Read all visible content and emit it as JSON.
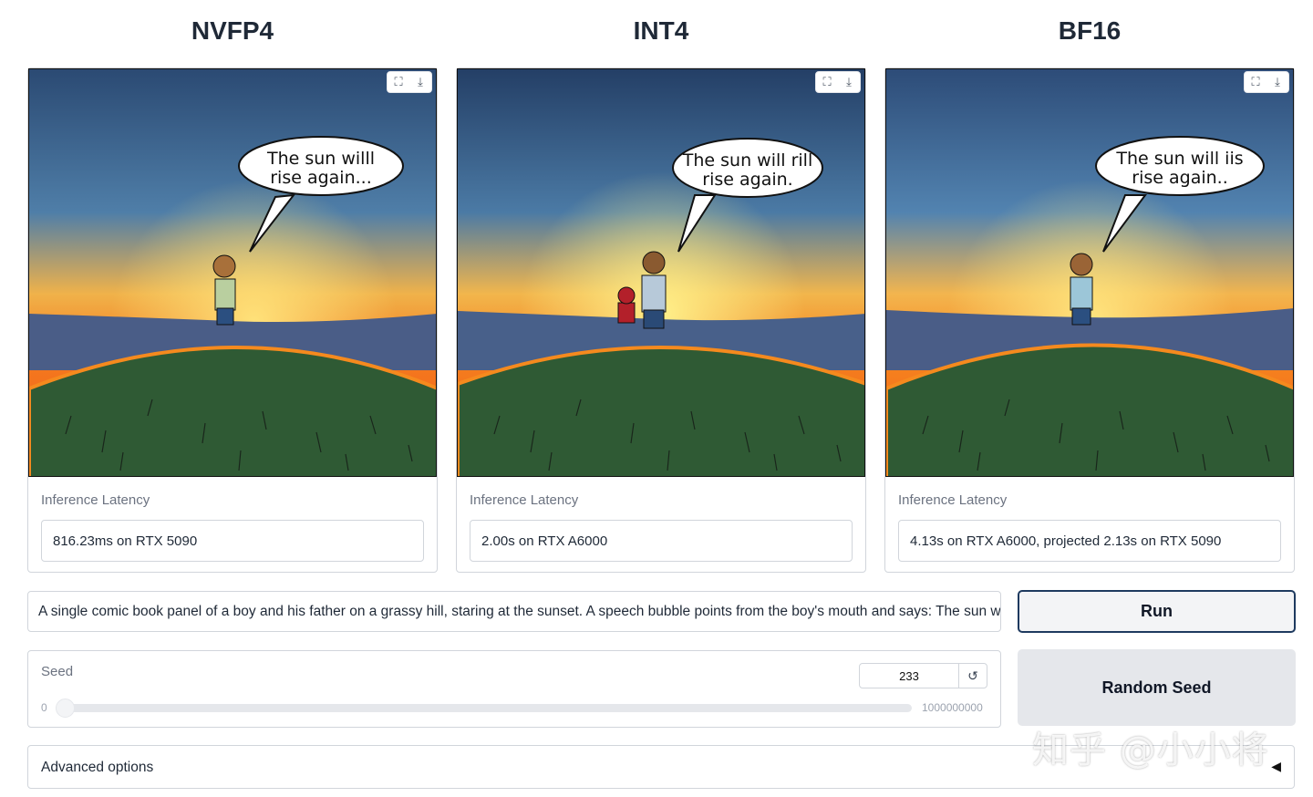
{
  "columns": [
    {
      "title": "NVFP4",
      "latency_label": "Inference Latency",
      "latency_value": "816.23ms on RTX 5090",
      "bubble_line1": "The sun willl",
      "bubble_line2": "rise again..."
    },
    {
      "title": "INT4",
      "latency_label": "Inference Latency",
      "latency_value": "2.00s on RTX A6000",
      "bubble_line1": "The sun will rill",
      "bubble_line2": "rise again."
    },
    {
      "title": "BF16",
      "latency_label": "Inference Latency",
      "latency_value": "4.13s on RTX A6000, projected 2.13s on RTX 5090",
      "bubble_line1": "The sun will iis",
      "bubble_line2": "rise again.."
    }
  ],
  "image_tools": {
    "fullscreen_icon": "fullscreen-icon",
    "download_icon": "download-icon"
  },
  "prompt": {
    "value": "A single comic book panel of a boy and his father on a grassy hill, staring at the sunset. A speech bubble points from the boy's mouth and says: The sun will"
  },
  "buttons": {
    "run": "Run",
    "random_seed": "Random Seed"
  },
  "seed": {
    "label": "Seed",
    "value": "233",
    "min": "0",
    "max": "1000000000",
    "reset_icon": "reset-icon"
  },
  "advanced": {
    "label": "Advanced options",
    "caret_icon": "caret-left-icon"
  },
  "watermark": {
    "text": "知乎 @小小将"
  },
  "colors": {
    "accent_border": "#1e3a5f",
    "button_bg": "#e5e7eb",
    "border": "#d1d5db"
  }
}
